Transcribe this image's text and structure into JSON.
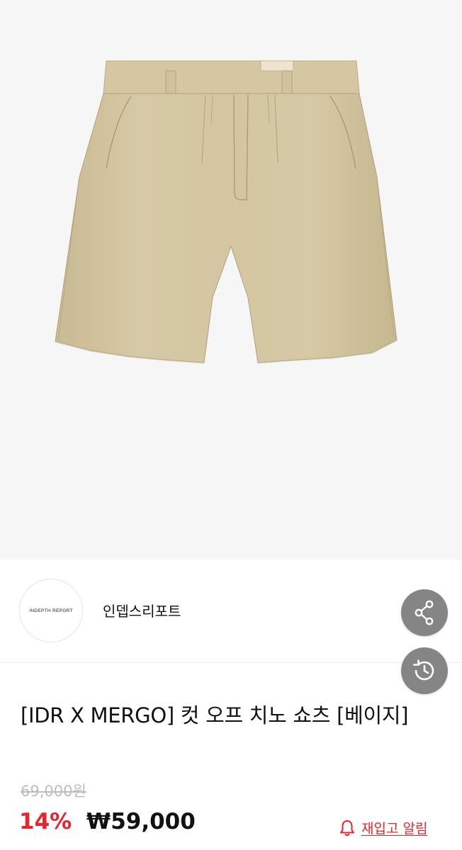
{
  "product": {
    "image_alt": "beige chino shorts",
    "title": "[IDR X MERGO] 컷 오프 치노 쇼츠 [베이지]",
    "original_price": "69,000원",
    "discount_rate": "14%",
    "sale_price": "₩59,000"
  },
  "brand": {
    "logo_text": "INDEPTH REPORT",
    "name": "인뎁스리포트"
  },
  "actions": {
    "share_icon": "share-icon",
    "history_icon": "history-icon",
    "restock_icon": "bell-icon",
    "restock_label": "재입고 알림"
  },
  "colors": {
    "accent_red": "#e8242c",
    "fab_gray": "#858585",
    "shorts_beige": "#d2c49f"
  }
}
